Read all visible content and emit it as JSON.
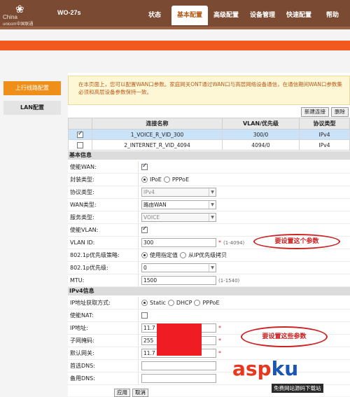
{
  "header": {
    "logo": {
      "cn_text": "China",
      "en_text": "unicom中国联通"
    },
    "model": "WO-27s",
    "nav": [
      {
        "label": "状态",
        "active": false
      },
      {
        "label": "基本配置",
        "active": true
      },
      {
        "label": "高级配置",
        "active": false
      },
      {
        "label": "设备管理",
        "active": false
      },
      {
        "label": "快速配置",
        "active": false
      },
      {
        "label": "帮助",
        "active": false
      }
    ]
  },
  "sidebar": {
    "items": [
      {
        "label": "上行线路配置",
        "active": true
      },
      {
        "label": "LAN配置",
        "active": false
      }
    ]
  },
  "notice": "在本页面上，您可以配置WAN口参数。家庭网关ONT通过WAN口与高层网络设备通信，在通信期间WAN口参数集必须和高层设备参数保持一致。",
  "toolbar": {
    "new_label": "新建连接",
    "delete_label": "删除"
  },
  "wan_table": {
    "headers": [
      "",
      "连接名称",
      "VLAN/优先级",
      "协议类型"
    ],
    "rows": [
      {
        "checked": true,
        "name": "1_VOICE_R_VID_300",
        "vlan": "300/0",
        "proto": "IPv4"
      },
      {
        "checked": false,
        "name": "2_INTERNET_R_VID_4094",
        "vlan": "4094/0",
        "proto": "IPv4"
      }
    ]
  },
  "basic": {
    "title": "基本信息",
    "enable_wan": {
      "label": "使能WAN:",
      "checked": true
    },
    "encap": {
      "label": "封装类型:",
      "opt1": "IPoE",
      "opt2": "PPPoE"
    },
    "protocol": {
      "label": "协议类型:",
      "value": "IPv4"
    },
    "wan_type": {
      "label": "WAN类型:",
      "value": "路由WAN"
    },
    "service": {
      "label": "服务类型:",
      "value": "VOICE"
    },
    "enable_vlan": {
      "label": "使能VLAN:",
      "checked": true
    },
    "vlan_id": {
      "label": "VLAN ID:",
      "value": "300",
      "star": "*",
      "hint": "(1-4094)"
    },
    "prio_policy": {
      "label": "802.1p优先级策略:",
      "opt1": "使用指定值",
      "opt2": "从IP优先级拷贝"
    },
    "prio": {
      "label": "802.1p优先级:",
      "value": "0"
    },
    "mtu": {
      "label": "MTU:",
      "value": "1500",
      "hint": "(1-1540)"
    }
  },
  "ipv4": {
    "title": "IPv4信息",
    "mode": {
      "label": "IP地址获取方式:",
      "opt1": "Static",
      "opt2": "DHCP",
      "opt3": "PPPoE"
    },
    "nat": {
      "label": "使能NAT:",
      "checked": false
    },
    "ip": {
      "label": "IP地址:",
      "value": "11.7",
      "star": "*"
    },
    "mask": {
      "label": "子网掩码:",
      "value": "255",
      "star": "*"
    },
    "gateway": {
      "label": "默认网关:",
      "value": "11.7",
      "star": "*"
    },
    "dns1": {
      "label": "首选DNS:",
      "value": ""
    },
    "dns2": {
      "label": "备用DNS:",
      "value": ""
    }
  },
  "annotations": {
    "note1": "要设置这个参数",
    "note2": "要设置这些参数"
  },
  "footer": {
    "apply_label": "应用",
    "cancel_label": "取消"
  },
  "watermark": {
    "brand_a": "asp",
    "brand_b": "ku",
    "sub": "免费网站源码下载站"
  },
  "colors": {
    "header": "#7a4b32",
    "accent": "#f1591f",
    "sidebar_active": "#ef8f19",
    "annotation": "#cc2222"
  }
}
